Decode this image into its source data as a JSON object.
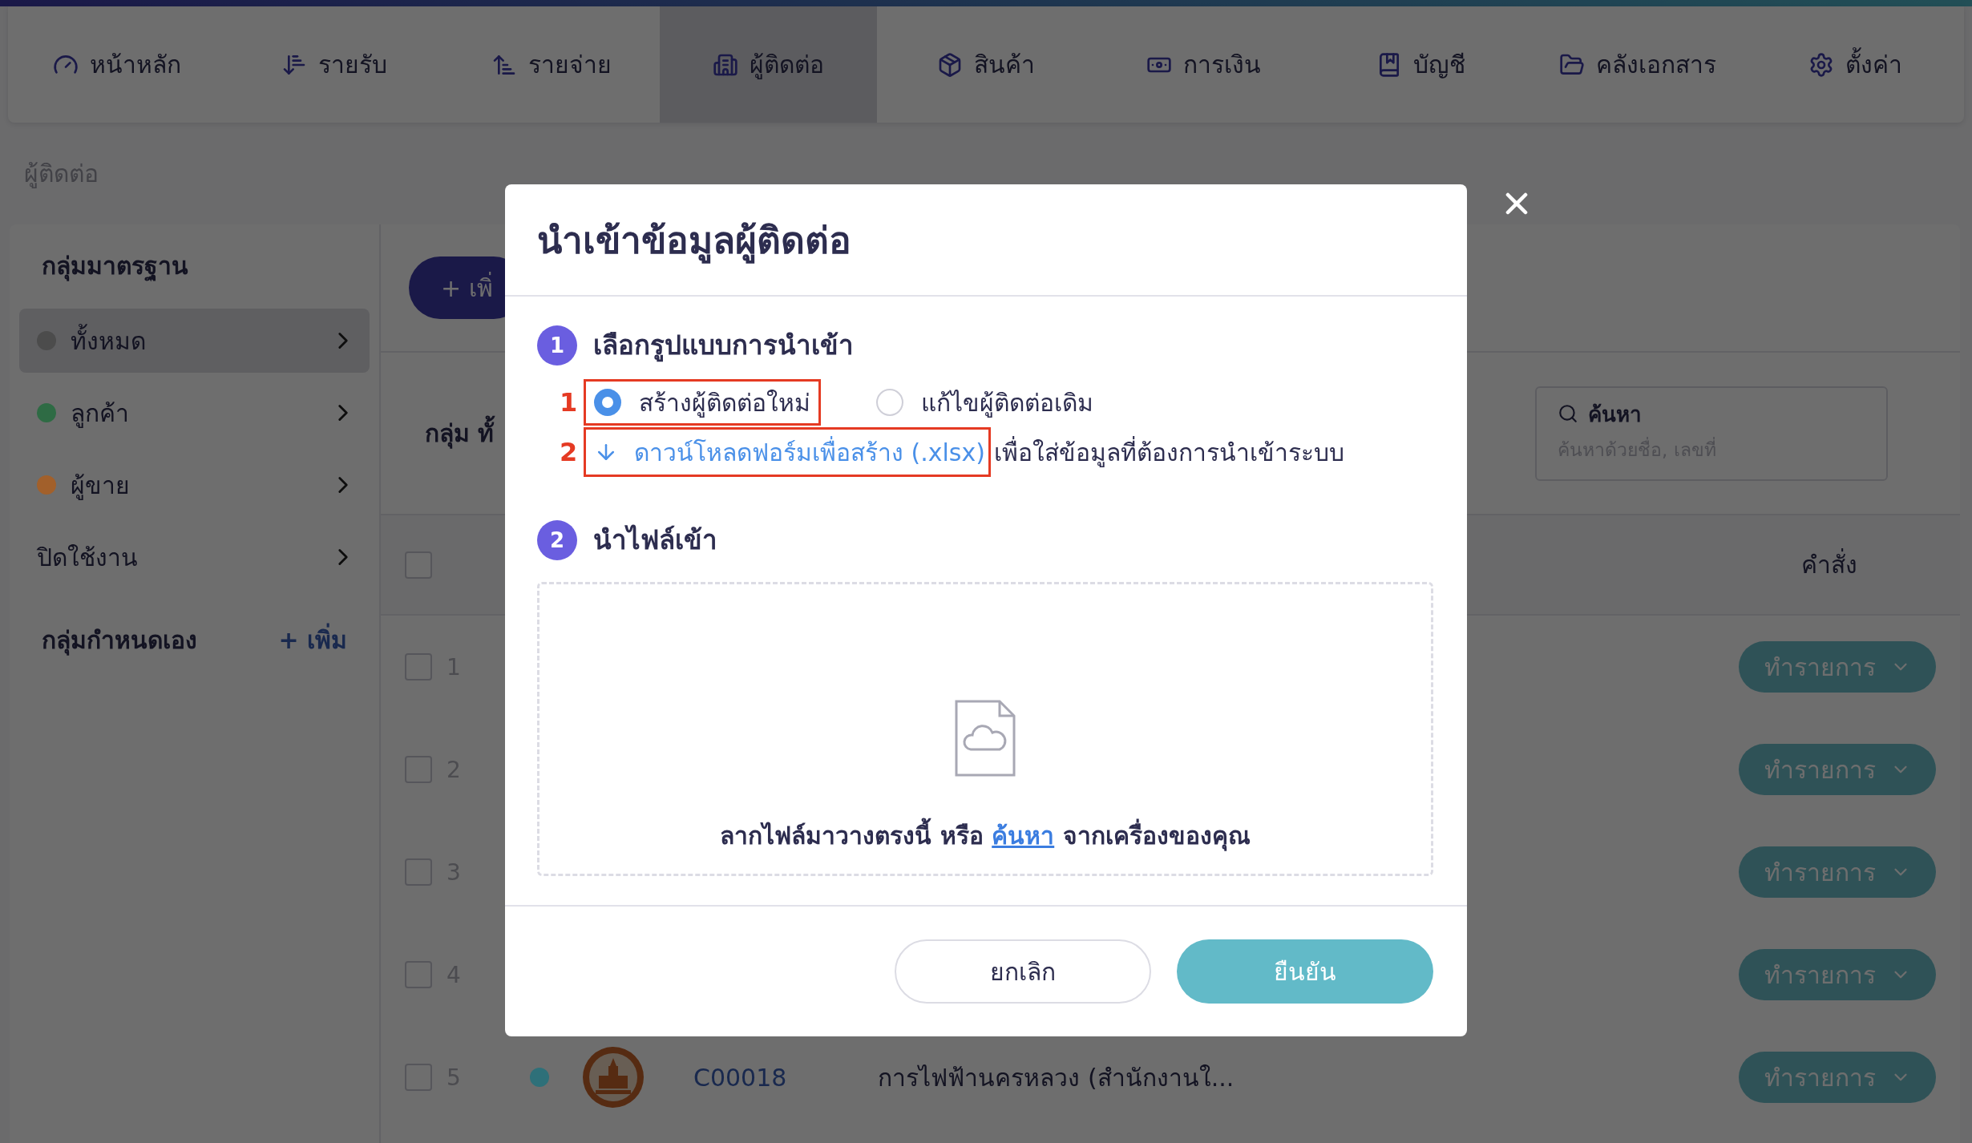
{
  "nav": {
    "tabs": [
      {
        "label": "หน้าหลัก",
        "selected": false
      },
      {
        "label": "รายรับ",
        "selected": false
      },
      {
        "label": "รายจ่าย",
        "selected": false
      },
      {
        "label": "ผู้ติดต่อ",
        "selected": true
      },
      {
        "label": "สินค้า",
        "selected": false
      },
      {
        "label": "การเงิน",
        "selected": false
      },
      {
        "label": "บัญชี",
        "selected": false
      },
      {
        "label": "คลังเอกสาร",
        "selected": false
      },
      {
        "label": "ตั้งค่า",
        "selected": false
      }
    ]
  },
  "breadcrumb": "ผู้ติดต่อ",
  "sidebar": {
    "standard_title": "กลุ่มมาตรฐาน",
    "items": [
      {
        "label": "ทั้งหมด",
        "color": "#4c4c4c",
        "selected": true
      },
      {
        "label": "ลูกค้า",
        "color": "#2e6b44",
        "selected": false
      },
      {
        "label": "ผู้ขาย",
        "color": "#a2602b",
        "selected": false
      },
      {
        "label": "ปิดใช้งาน",
        "selected": false
      }
    ],
    "custom_title": "กลุ่มกำหนดเอง",
    "add_link": "+ เพิ่ม"
  },
  "toolbar": {
    "add_button": "+ เพิ่"
  },
  "filter": {
    "group_label": "กลุ่ม ทั้",
    "search_label": "ค้นหา",
    "search_placeholder": "ค้นหาด้วยชื่อ, เลขที่"
  },
  "table": {
    "header": {
      "checked": false,
      "action": "คำสั่ง"
    },
    "rows": [
      {
        "number": "1",
        "checked": false,
        "action": "ทำรายการ"
      },
      {
        "number": "2",
        "checked": false,
        "action": "ทำรายการ"
      },
      {
        "number": "3",
        "checked": false,
        "action": "ทำรายการ"
      },
      {
        "number": "4",
        "checked": false,
        "action": "ทำรายการ"
      },
      {
        "number": "5",
        "checked": false,
        "color": "#2e7079",
        "code": "C00018",
        "name": "การไฟฟ้านครหลวง (สำนักงานใ...",
        "action": "ทำรายการ"
      }
    ]
  },
  "dialog": {
    "title": "นำเข้าข้อมูลผู้ติดต่อ",
    "step1": {
      "number": "1",
      "title": "เลือกรูปแบบการนำเข้า",
      "option_row": {
        "annotation": "1",
        "options": [
          {
            "label": "สร้างผู้ติดต่อใหม่",
            "selected": true,
            "highlighted": true
          },
          {
            "label": "แก้ไขผู้ติดต่อเดิม",
            "selected": false,
            "highlighted": false
          }
        ]
      },
      "download_row": {
        "annotation": "2",
        "link": "ดาวน์โหลดฟอร์มเพื่อสร้าง (.xlsx)",
        "note": "เพื่อใส่ข้อมูลที่ต้องการนำเข้าระบบ",
        "highlighted": true
      }
    },
    "step2": {
      "number": "2",
      "title": "นำไฟล์เข้า",
      "drop_text_before": "ลากไฟล์มาวางตรงนี้ หรือ",
      "drop_link": "ค้นหา",
      "drop_text_after": "จากเครื่องของคุณ"
    },
    "cancel": "ยกเลิก",
    "confirm": "ยืนยัน"
  }
}
